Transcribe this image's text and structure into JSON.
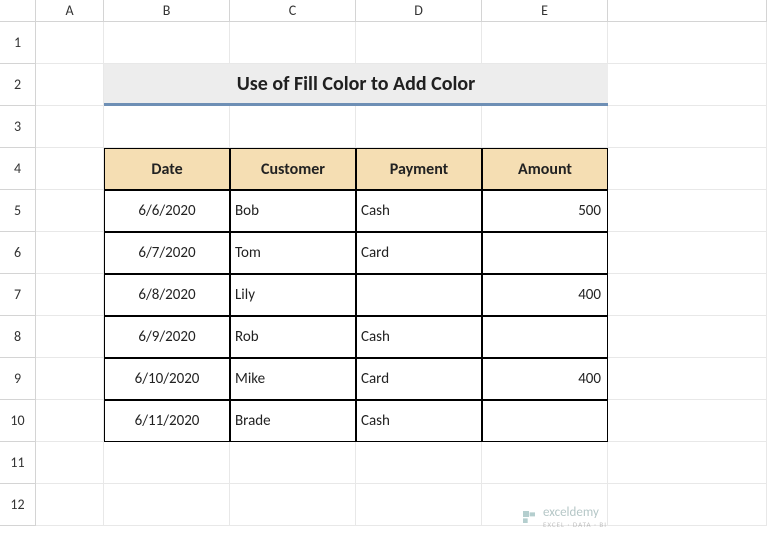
{
  "columns": [
    "A",
    "B",
    "C",
    "D",
    "E"
  ],
  "rows": [
    "1",
    "2",
    "3",
    "4",
    "5",
    "6",
    "7",
    "8",
    "9",
    "10",
    "11",
    "12"
  ],
  "title": "Use of Fill Color to Add Color",
  "headers": {
    "date": "Date",
    "customer": "Customer",
    "payment": "Payment",
    "amount": "Amount"
  },
  "data": [
    {
      "date": "6/6/2020",
      "customer": "Bob",
      "payment": "Cash",
      "amount": "500"
    },
    {
      "date": "6/7/2020",
      "customer": "Tom",
      "payment": "Card",
      "amount": ""
    },
    {
      "date": "6/8/2020",
      "customer": "Lily",
      "payment": "",
      "amount": "400"
    },
    {
      "date": "6/9/2020",
      "customer": "Rob",
      "payment": "Cash",
      "amount": ""
    },
    {
      "date": "6/10/2020",
      "customer": "Mike",
      "payment": "Card",
      "amount": "400"
    },
    {
      "date": "6/11/2020",
      "customer": "Brade",
      "payment": "Cash",
      "amount": ""
    }
  ],
  "watermark": {
    "name": "exceldemy",
    "tagline": "EXCEL · DATA · BI"
  }
}
